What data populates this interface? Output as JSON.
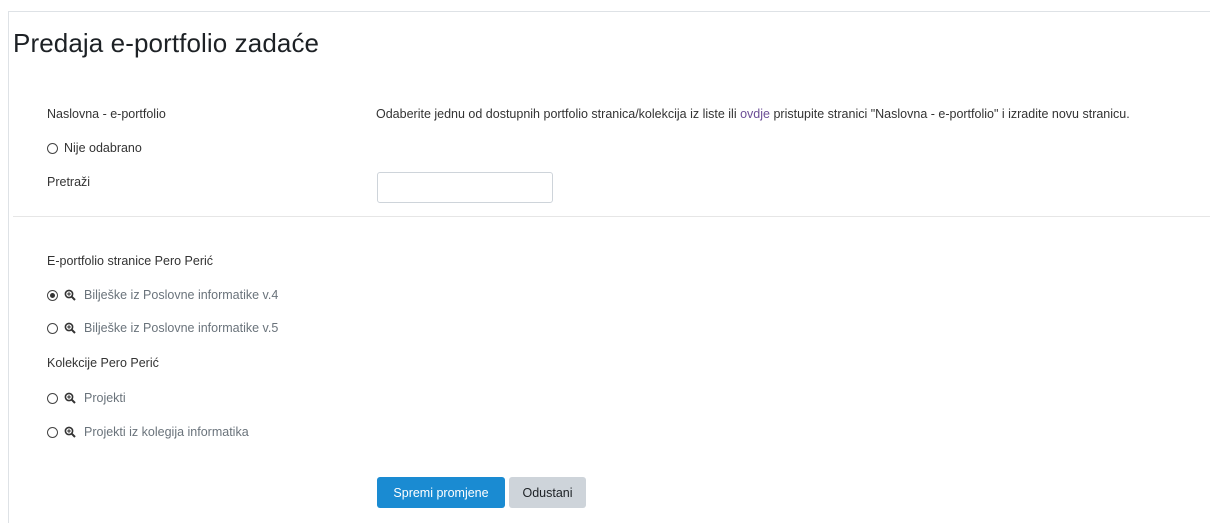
{
  "page": {
    "title": "Predaja e-portfolio zadaće"
  },
  "form": {
    "field_label": "Naslovna - e-portfolio",
    "description": {
      "before_link": "Odaberite jednu od dostupnih portfolio stranica/kolekcija iz liste ili ",
      "link_text": "ovdje",
      "after_link": " pristupite stranici \"Naslovna - e-portfolio\" i izradite novu stranicu."
    },
    "none_option": {
      "label": "Nije odabrano",
      "selected": false
    },
    "search": {
      "label": "Pretraži",
      "value": "",
      "placeholder": ""
    },
    "pages_section": {
      "heading": "E-portfolio stranice Pero Perić",
      "items": [
        {
          "label": "Bilješke iz Poslovne informatike v.4",
          "selected": true,
          "icon": "zoom-icon"
        },
        {
          "label": "Bilješke iz Poslovne informatike v.5",
          "selected": false,
          "icon": "zoom-icon"
        }
      ]
    },
    "collections_section": {
      "heading": "Kolekcije Pero Perić",
      "items": [
        {
          "label": "Projekti",
          "selected": false,
          "icon": "zoom-icon"
        },
        {
          "label": "Projekti iz kolegija informatika",
          "selected": false,
          "icon": "zoom-icon"
        }
      ]
    },
    "buttons": {
      "save": "Spremi promjene",
      "cancel": "Odustani"
    }
  },
  "colors": {
    "primary_button": "#1a8bd2",
    "secondary_button": "#ced4da",
    "link": "#6c4e96"
  }
}
